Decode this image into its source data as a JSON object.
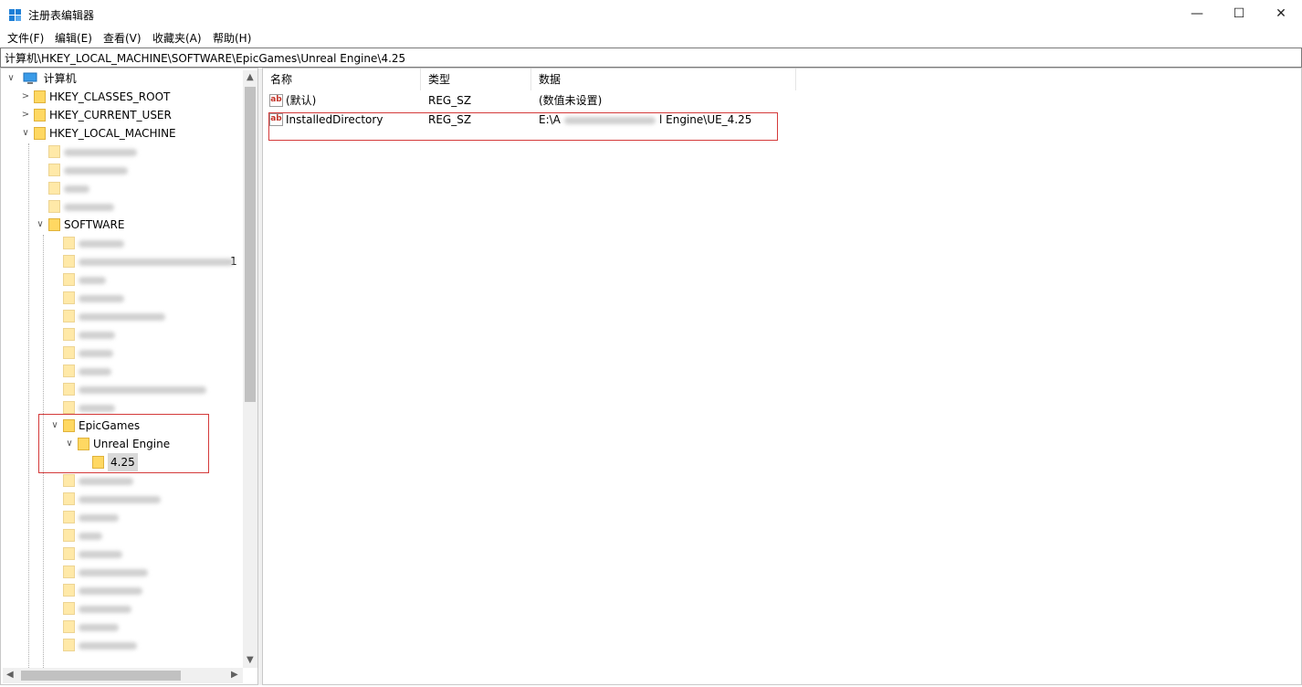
{
  "window": {
    "title": "注册表编辑器",
    "minimize_glyph": "—",
    "maximize_glyph": "☐",
    "close_glyph": "✕"
  },
  "menu": [
    "文件(F)",
    "编辑(E)",
    "查看(V)",
    "收藏夹(A)",
    "帮助(H)"
  ],
  "address": "计算机\\HKEY_LOCAL_MACHINE\\SOFTWARE\\EpicGames\\Unreal Engine\\4.25",
  "tree": {
    "root": "计算机",
    "hkcr": "HKEY_CLASSES_ROOT",
    "hkcu": "HKEY_CURRENT_USER",
    "hklm": "HKEY_LOCAL_MACHINE",
    "software": "SOFTWARE",
    "epic": "EpicGames",
    "unreal": "Unreal Engine",
    "version": "4.25",
    "partial_char": "1"
  },
  "list": {
    "headers": {
      "name": "名称",
      "type": "类型",
      "data": "数据"
    },
    "rows": [
      {
        "name": "(默认)",
        "type": "REG_SZ",
        "data": "(数值未设置)"
      },
      {
        "name": "InstalledDirectory",
        "type": "REG_SZ",
        "data_prefix": "E:\\A",
        "data_suffix": "l Engine\\UE_4.25"
      }
    ]
  },
  "colors": {
    "accent_highlight": "#d43a3a",
    "folder": "#ffd862",
    "computer_icon": "#1e90ff"
  },
  "icons": {
    "string_value": "ab-string-icon",
    "folder": "folder-icon",
    "computer": "computer-icon"
  }
}
